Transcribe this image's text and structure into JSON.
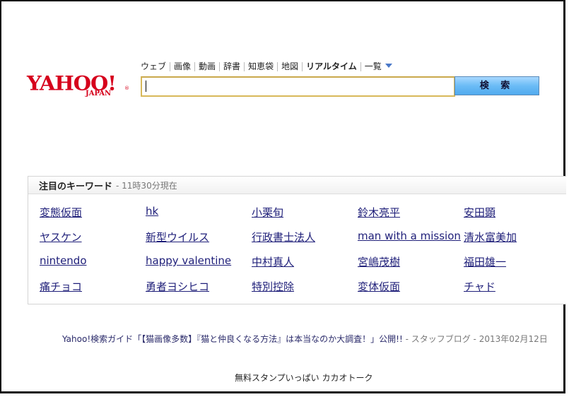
{
  "logo": {
    "main": "YAHOO!",
    "sub": "JAPAN",
    "reg": "®"
  },
  "tabs": [
    {
      "label": "ウェブ",
      "bold": false
    },
    {
      "label": "画像",
      "bold": false
    },
    {
      "label": "動画",
      "bold": false
    },
    {
      "label": "辞書",
      "bold": false
    },
    {
      "label": "知恵袋",
      "bold": false
    },
    {
      "label": "地図",
      "bold": false
    },
    {
      "label": "リアルタイム",
      "bold": true
    },
    {
      "label": "一覧",
      "bold": false,
      "dropdown": true
    }
  ],
  "search": {
    "value": "",
    "button_label": "検 索"
  },
  "keywords": {
    "title": "注目のキーワード",
    "time": "- 11時30分現在",
    "rows": [
      [
        "変態仮面",
        "hk",
        "小栗旬",
        "鈴木亮平",
        "安田顕"
      ],
      [
        "ヤスケン",
        "新型ウイルス",
        "行政書士法人",
        "man with a mission",
        "清水富美加"
      ],
      [
        "nintendo",
        "happy valentine",
        "中村真人",
        "宮嶋茂樹",
        "福田雄一"
      ],
      [
        "痛チョコ",
        "勇者ヨシヒコ",
        "特別控除",
        "変体仮面",
        "チャド"
      ]
    ]
  },
  "news": {
    "link": "Yahoo!検索ガイド「【猫画像多数】『猫と仲良くなる方法』は本当なのか大調査！」公開!!",
    "source": " - スタッフブログ",
    "date": " - 2013年02月12日"
  },
  "footer": {
    "link": "無料スタンプいっぱい カカオトーク"
  }
}
